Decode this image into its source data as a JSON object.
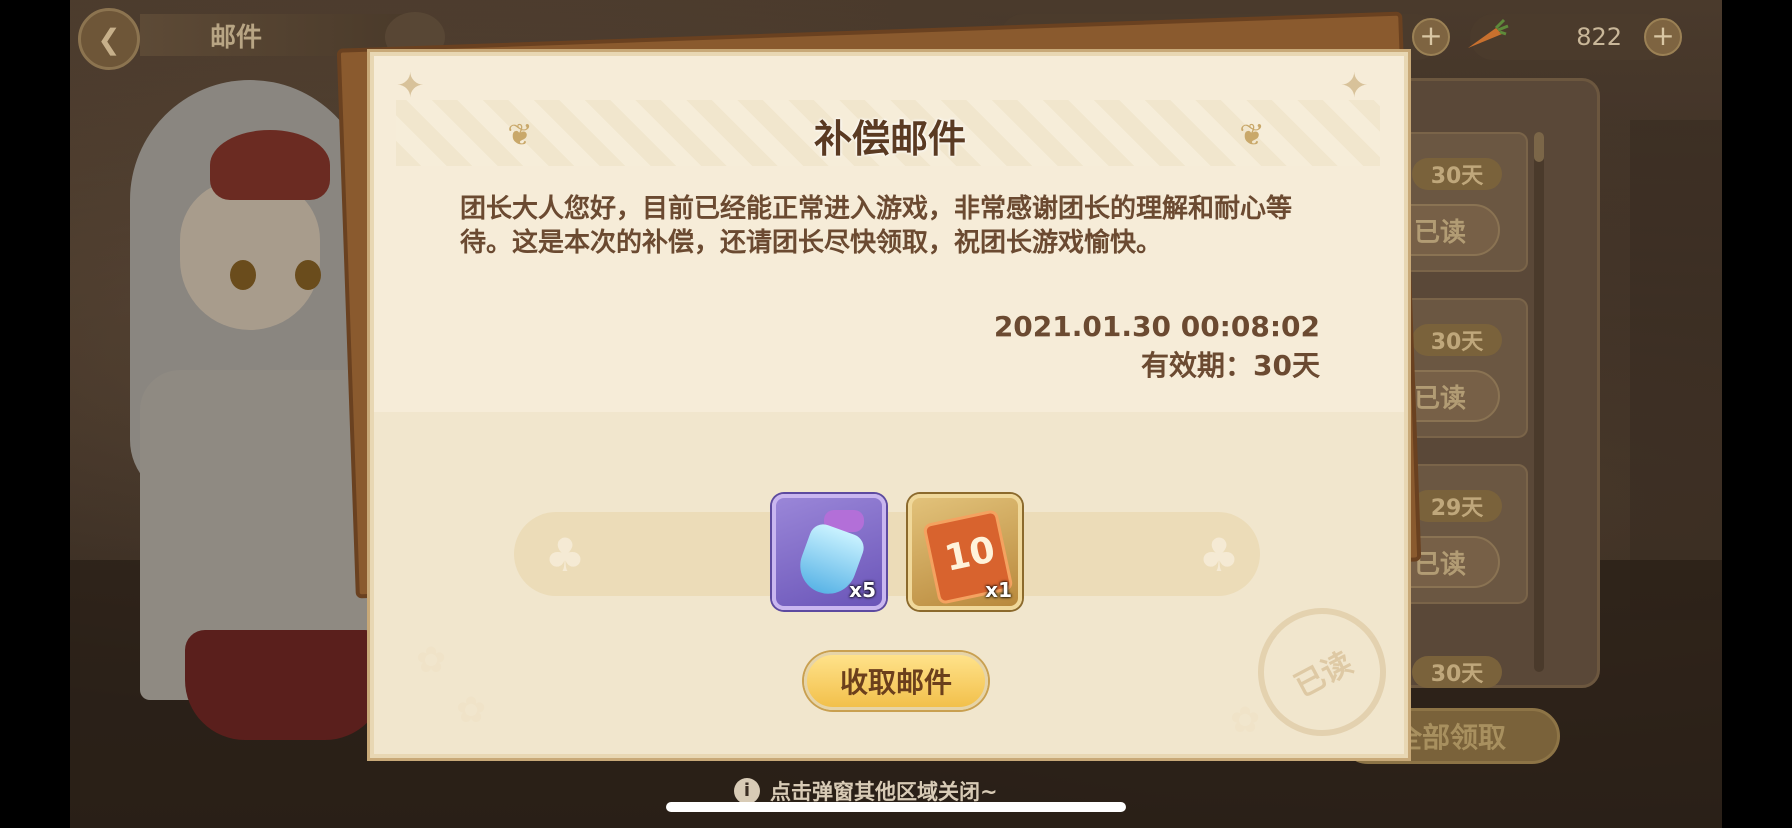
{
  "header": {
    "title": "邮件",
    "carrot_count": "822"
  },
  "popup": {
    "title": "补偿邮件",
    "message": "团长大人您好，目前已经能正常进入游戏，非常感谢团长的理解和耐心等待。这是本次的补偿，还请团长尽快领取，祝团长游戏愉快。",
    "date": "2021.01.30  00:08:02",
    "expiry": "有效期：30天",
    "rewards": [
      {
        "icon": "potion-icon",
        "count": "x5"
      },
      {
        "icon": "gacha-ticket-icon",
        "count": "x1"
      }
    ],
    "claim_label": "收取邮件",
    "stamp_label": "已读"
  },
  "mail_list": {
    "items": [
      {
        "days": "30天",
        "read_label": "已读"
      },
      {
        "days": "30天",
        "read_label": "已读"
      },
      {
        "days": "29天",
        "read_label": "已读"
      },
      {
        "days": "30天",
        "read_label": ""
      }
    ],
    "claim_all_label": "全部领取"
  },
  "footer": {
    "hint": "点击弹窗其他区域关闭~"
  }
}
